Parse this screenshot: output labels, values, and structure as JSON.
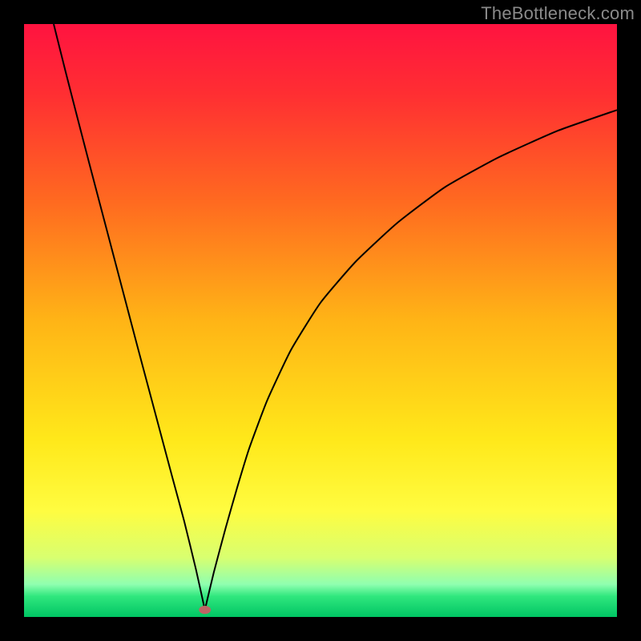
{
  "watermark": "TheBottleneck.com",
  "chart_data": {
    "type": "line",
    "title": "",
    "xlabel": "",
    "ylabel": "",
    "xlim": [
      0,
      100
    ],
    "ylim": [
      0,
      100
    ],
    "grid": false,
    "background_gradient": {
      "stops": [
        {
          "offset": 0.0,
          "color": "#ff1340"
        },
        {
          "offset": 0.12,
          "color": "#ff2f32"
        },
        {
          "offset": 0.3,
          "color": "#ff6a20"
        },
        {
          "offset": 0.5,
          "color": "#ffb416"
        },
        {
          "offset": 0.7,
          "color": "#ffe81a"
        },
        {
          "offset": 0.82,
          "color": "#fffc40"
        },
        {
          "offset": 0.9,
          "color": "#d8ff70"
        },
        {
          "offset": 0.945,
          "color": "#8fffb0"
        },
        {
          "offset": 0.965,
          "color": "#30e77e"
        },
        {
          "offset": 1.0,
          "color": "#00c564"
        }
      ]
    },
    "minimum_point": {
      "x": 30.5,
      "y": 1.2
    },
    "marker": {
      "x": 30.5,
      "y": 1.2,
      "rx": 1.0,
      "ry": 0.7,
      "color": "#bd6464"
    },
    "series": [
      {
        "name": "left-branch",
        "x": [
          5.0,
          7.0,
          9.0,
          11.0,
          13.0,
          15.0,
          17.0,
          19.0,
          21.0,
          23.0,
          25.0,
          27.0,
          29.0,
          30.5
        ],
        "y": [
          100.0,
          92.0,
          84.2,
          76.5,
          68.9,
          61.3,
          53.7,
          46.1,
          38.6,
          31.1,
          23.6,
          16.2,
          8.0,
          1.2
        ]
      },
      {
        "name": "right-branch",
        "x": [
          30.5,
          32.0,
          34.0,
          36.0,
          38.0,
          41.0,
          45.0,
          50.0,
          56.0,
          63.0,
          71.0,
          80.0,
          90.0,
          100.0
        ],
        "y": [
          1.2,
          7.5,
          15.0,
          22.0,
          28.5,
          36.5,
          45.0,
          53.0,
          60.0,
          66.5,
          72.5,
          77.5,
          82.0,
          85.5
        ]
      }
    ]
  }
}
